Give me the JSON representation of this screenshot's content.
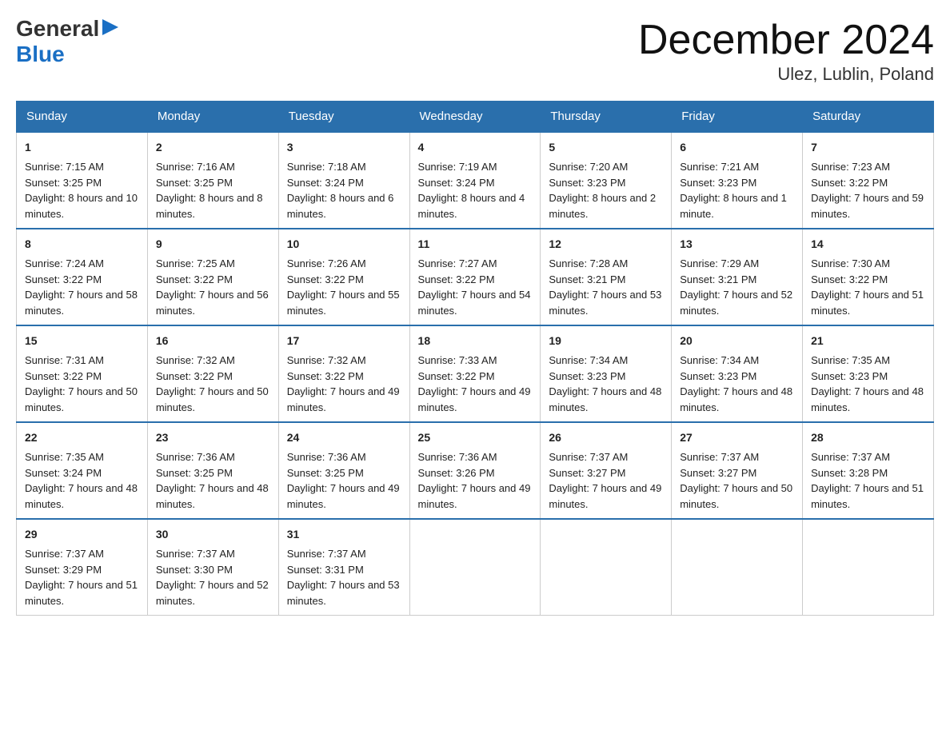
{
  "header": {
    "logo_general": "General",
    "logo_blue": "Blue",
    "title": "December 2024",
    "subtitle": "Ulez, Lublin, Poland"
  },
  "days_of_week": [
    "Sunday",
    "Monday",
    "Tuesday",
    "Wednesday",
    "Thursday",
    "Friday",
    "Saturday"
  ],
  "weeks": [
    [
      {
        "day": "1",
        "sunrise": "Sunrise: 7:15 AM",
        "sunset": "Sunset: 3:25 PM",
        "daylight": "Daylight: 8 hours and 10 minutes."
      },
      {
        "day": "2",
        "sunrise": "Sunrise: 7:16 AM",
        "sunset": "Sunset: 3:25 PM",
        "daylight": "Daylight: 8 hours and 8 minutes."
      },
      {
        "day": "3",
        "sunrise": "Sunrise: 7:18 AM",
        "sunset": "Sunset: 3:24 PM",
        "daylight": "Daylight: 8 hours and 6 minutes."
      },
      {
        "day": "4",
        "sunrise": "Sunrise: 7:19 AM",
        "sunset": "Sunset: 3:24 PM",
        "daylight": "Daylight: 8 hours and 4 minutes."
      },
      {
        "day": "5",
        "sunrise": "Sunrise: 7:20 AM",
        "sunset": "Sunset: 3:23 PM",
        "daylight": "Daylight: 8 hours and 2 minutes."
      },
      {
        "day": "6",
        "sunrise": "Sunrise: 7:21 AM",
        "sunset": "Sunset: 3:23 PM",
        "daylight": "Daylight: 8 hours and 1 minute."
      },
      {
        "day": "7",
        "sunrise": "Sunrise: 7:23 AM",
        "sunset": "Sunset: 3:22 PM",
        "daylight": "Daylight: 7 hours and 59 minutes."
      }
    ],
    [
      {
        "day": "8",
        "sunrise": "Sunrise: 7:24 AM",
        "sunset": "Sunset: 3:22 PM",
        "daylight": "Daylight: 7 hours and 58 minutes."
      },
      {
        "day": "9",
        "sunrise": "Sunrise: 7:25 AM",
        "sunset": "Sunset: 3:22 PM",
        "daylight": "Daylight: 7 hours and 56 minutes."
      },
      {
        "day": "10",
        "sunrise": "Sunrise: 7:26 AM",
        "sunset": "Sunset: 3:22 PM",
        "daylight": "Daylight: 7 hours and 55 minutes."
      },
      {
        "day": "11",
        "sunrise": "Sunrise: 7:27 AM",
        "sunset": "Sunset: 3:22 PM",
        "daylight": "Daylight: 7 hours and 54 minutes."
      },
      {
        "day": "12",
        "sunrise": "Sunrise: 7:28 AM",
        "sunset": "Sunset: 3:21 PM",
        "daylight": "Daylight: 7 hours and 53 minutes."
      },
      {
        "day": "13",
        "sunrise": "Sunrise: 7:29 AM",
        "sunset": "Sunset: 3:21 PM",
        "daylight": "Daylight: 7 hours and 52 minutes."
      },
      {
        "day": "14",
        "sunrise": "Sunrise: 7:30 AM",
        "sunset": "Sunset: 3:22 PM",
        "daylight": "Daylight: 7 hours and 51 minutes."
      }
    ],
    [
      {
        "day": "15",
        "sunrise": "Sunrise: 7:31 AM",
        "sunset": "Sunset: 3:22 PM",
        "daylight": "Daylight: 7 hours and 50 minutes."
      },
      {
        "day": "16",
        "sunrise": "Sunrise: 7:32 AM",
        "sunset": "Sunset: 3:22 PM",
        "daylight": "Daylight: 7 hours and 50 minutes."
      },
      {
        "day": "17",
        "sunrise": "Sunrise: 7:32 AM",
        "sunset": "Sunset: 3:22 PM",
        "daylight": "Daylight: 7 hours and 49 minutes."
      },
      {
        "day": "18",
        "sunrise": "Sunrise: 7:33 AM",
        "sunset": "Sunset: 3:22 PM",
        "daylight": "Daylight: 7 hours and 49 minutes."
      },
      {
        "day": "19",
        "sunrise": "Sunrise: 7:34 AM",
        "sunset": "Sunset: 3:23 PM",
        "daylight": "Daylight: 7 hours and 48 minutes."
      },
      {
        "day": "20",
        "sunrise": "Sunrise: 7:34 AM",
        "sunset": "Sunset: 3:23 PM",
        "daylight": "Daylight: 7 hours and 48 minutes."
      },
      {
        "day": "21",
        "sunrise": "Sunrise: 7:35 AM",
        "sunset": "Sunset: 3:23 PM",
        "daylight": "Daylight: 7 hours and 48 minutes."
      }
    ],
    [
      {
        "day": "22",
        "sunrise": "Sunrise: 7:35 AM",
        "sunset": "Sunset: 3:24 PM",
        "daylight": "Daylight: 7 hours and 48 minutes."
      },
      {
        "day": "23",
        "sunrise": "Sunrise: 7:36 AM",
        "sunset": "Sunset: 3:25 PM",
        "daylight": "Daylight: 7 hours and 48 minutes."
      },
      {
        "day": "24",
        "sunrise": "Sunrise: 7:36 AM",
        "sunset": "Sunset: 3:25 PM",
        "daylight": "Daylight: 7 hours and 49 minutes."
      },
      {
        "day": "25",
        "sunrise": "Sunrise: 7:36 AM",
        "sunset": "Sunset: 3:26 PM",
        "daylight": "Daylight: 7 hours and 49 minutes."
      },
      {
        "day": "26",
        "sunrise": "Sunrise: 7:37 AM",
        "sunset": "Sunset: 3:27 PM",
        "daylight": "Daylight: 7 hours and 49 minutes."
      },
      {
        "day": "27",
        "sunrise": "Sunrise: 7:37 AM",
        "sunset": "Sunset: 3:27 PM",
        "daylight": "Daylight: 7 hours and 50 minutes."
      },
      {
        "day": "28",
        "sunrise": "Sunrise: 7:37 AM",
        "sunset": "Sunset: 3:28 PM",
        "daylight": "Daylight: 7 hours and 51 minutes."
      }
    ],
    [
      {
        "day": "29",
        "sunrise": "Sunrise: 7:37 AM",
        "sunset": "Sunset: 3:29 PM",
        "daylight": "Daylight: 7 hours and 51 minutes."
      },
      {
        "day": "30",
        "sunrise": "Sunrise: 7:37 AM",
        "sunset": "Sunset: 3:30 PM",
        "daylight": "Daylight: 7 hours and 52 minutes."
      },
      {
        "day": "31",
        "sunrise": "Sunrise: 7:37 AM",
        "sunset": "Sunset: 3:31 PM",
        "daylight": "Daylight: 7 hours and 53 minutes."
      },
      null,
      null,
      null,
      null
    ]
  ]
}
